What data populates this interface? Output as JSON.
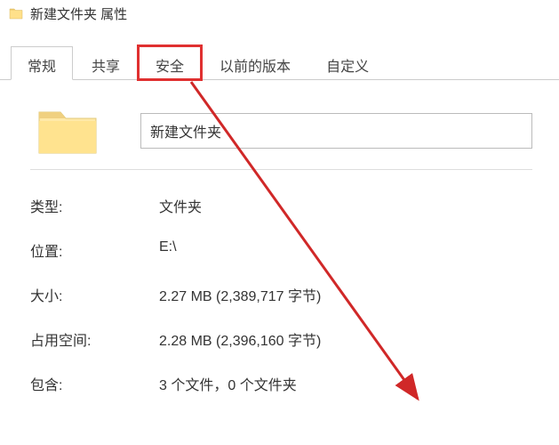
{
  "window": {
    "title": "新建文件夹 属性"
  },
  "tabs": {
    "general": "常规",
    "sharing": "共享",
    "security": "安全",
    "previous": "以前的版本",
    "customize": "自定义"
  },
  "folder": {
    "name": "新建文件夹"
  },
  "props": {
    "type_label": "类型:",
    "type_value": "文件夹",
    "location_label": "位置:",
    "location_value": "E:\\",
    "size_label": "大小:",
    "size_value": "2.27 MB (2,389,717 字节)",
    "size_on_disk_label": "占用空间:",
    "size_on_disk_value": "2.28 MB (2,396,160 字节)",
    "contains_label": "包含:",
    "contains_value": "3 个文件，0 个文件夹"
  }
}
